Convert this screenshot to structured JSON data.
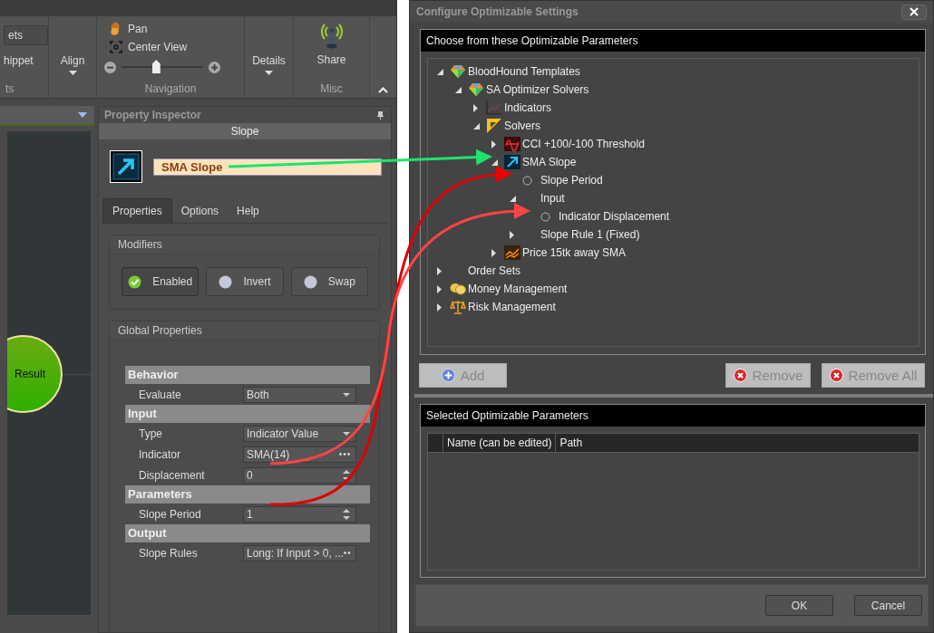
{
  "ribbon": {
    "partial_group": {
      "buttons": [
        "ets",
        "hippet"
      ],
      "caption": "ts"
    },
    "align_button": "Align",
    "navigation": {
      "pan": "Pan",
      "center_view": "Center View",
      "zoom": {
        "level": 0.42
      },
      "caption": "Navigation"
    },
    "details_button": "Details",
    "share_button": "Share",
    "misc_caption": "Misc"
  },
  "left_panel": {
    "canvas_node": "Result"
  },
  "property_inspector": {
    "title": "Property Inspector",
    "subtitle": "Slope",
    "name_value": "SMA Slope",
    "tabs": [
      {
        "label": "Properties",
        "selected": true
      },
      {
        "label": "Options",
        "selected": false
      },
      {
        "label": "Help",
        "selected": false
      }
    ],
    "modifiers": {
      "title": "Modifiers",
      "buttons": [
        {
          "label": "Enabled",
          "checked": true
        },
        {
          "label": "Invert",
          "checked": false
        },
        {
          "label": "Swap",
          "checked": false
        }
      ]
    },
    "global_properties": {
      "title": "Global Properties",
      "categories": [
        {
          "name": "Behavior",
          "rows": [
            {
              "label": "Evaluate",
              "value": "Both",
              "kind": "dropdown"
            }
          ]
        },
        {
          "name": "Input",
          "rows": [
            {
              "label": "Type",
              "value": "Indicator Value",
              "kind": "dropdown"
            },
            {
              "label": "Indicator",
              "value": "SMA(14)",
              "kind": "ellipsis"
            },
            {
              "label": "Displacement",
              "value": "0",
              "kind": "spinner"
            }
          ]
        },
        {
          "name": "Parameters",
          "rows": [
            {
              "label": "Slope Period",
              "value": "1",
              "kind": "spinner"
            }
          ]
        },
        {
          "name": "Output",
          "rows": [
            {
              "label": "Slope Rules",
              "value": "Long: If Input > 0, ...",
              "kind": "ellipsis"
            }
          ]
        }
      ]
    }
  },
  "dialog": {
    "title": "Configure Optimizable Settings",
    "tree_header": "Choose from these Optimizable Parameters",
    "tree": [
      {
        "label": "BloodHound Templates",
        "kind": "template",
        "expanded": true,
        "children": [
          {
            "label": "SA Optimizer Solvers",
            "kind": "template",
            "expanded": true,
            "children": [
              {
                "label": "Indicators",
                "kind": "indicators",
                "expanded": false
              },
              {
                "label": "Solvers",
                "kind": "solvers",
                "expanded": true,
                "children": [
                  {
                    "label": "CCI +100/-100 Threshold",
                    "kind": "wave",
                    "expanded": false
                  },
                  {
                    "label": "SMA Slope",
                    "kind": "slope",
                    "expanded": true,
                    "children": [
                      {
                        "label": "Slope Period",
                        "kind": "parameter",
                        "checked": false
                      },
                      {
                        "label": "Input",
                        "kind": "folder",
                        "expanded": true,
                        "children": [
                          {
                            "label": "Indicator Displacement",
                            "kind": "parameter",
                            "checked": false
                          }
                        ]
                      },
                      {
                        "label": "Slope Rule 1 (Fixed)",
                        "kind": "folder",
                        "expanded": false
                      }
                    ]
                  },
                  {
                    "label": "Price 15tk away SMA",
                    "kind": "price",
                    "expanded": false
                  }
                ]
              }
            ]
          }
        ]
      },
      {
        "label": "Order Sets",
        "kind": "group",
        "expanded": false
      },
      {
        "label": "Money Management",
        "kind": "money",
        "expanded": false
      },
      {
        "label": "Risk Management",
        "kind": "risk",
        "expanded": false
      }
    ],
    "action_buttons": [
      {
        "label": "Add",
        "kind": "add",
        "disabled": true
      },
      {
        "label": "Remove",
        "kind": "remove",
        "disabled": true
      },
      {
        "label": "Remove All",
        "kind": "remove",
        "disabled": true
      }
    ],
    "selected_header": "Selected Optimizable Parameters",
    "columns": [
      "Name (can be edited)",
      "Path"
    ],
    "footer_buttons": [
      "OK",
      "Cancel"
    ]
  }
}
